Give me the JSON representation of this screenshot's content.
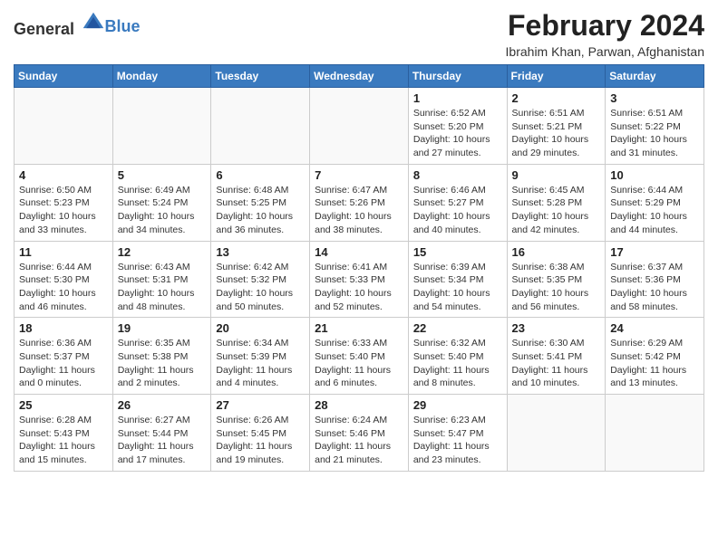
{
  "logo": {
    "general": "General",
    "blue": "Blue"
  },
  "header": {
    "title": "February 2024",
    "subtitle": "Ibrahim Khan, Parwan, Afghanistan"
  },
  "weekdays": [
    "Sunday",
    "Monday",
    "Tuesday",
    "Wednesday",
    "Thursday",
    "Friday",
    "Saturday"
  ],
  "weeks": [
    [
      {
        "day": "",
        "info": ""
      },
      {
        "day": "",
        "info": ""
      },
      {
        "day": "",
        "info": ""
      },
      {
        "day": "",
        "info": ""
      },
      {
        "day": "1",
        "info": "Sunrise: 6:52 AM\nSunset: 5:20 PM\nDaylight: 10 hours and 27 minutes."
      },
      {
        "day": "2",
        "info": "Sunrise: 6:51 AM\nSunset: 5:21 PM\nDaylight: 10 hours and 29 minutes."
      },
      {
        "day": "3",
        "info": "Sunrise: 6:51 AM\nSunset: 5:22 PM\nDaylight: 10 hours and 31 minutes."
      }
    ],
    [
      {
        "day": "4",
        "info": "Sunrise: 6:50 AM\nSunset: 5:23 PM\nDaylight: 10 hours and 33 minutes."
      },
      {
        "day": "5",
        "info": "Sunrise: 6:49 AM\nSunset: 5:24 PM\nDaylight: 10 hours and 34 minutes."
      },
      {
        "day": "6",
        "info": "Sunrise: 6:48 AM\nSunset: 5:25 PM\nDaylight: 10 hours and 36 minutes."
      },
      {
        "day": "7",
        "info": "Sunrise: 6:47 AM\nSunset: 5:26 PM\nDaylight: 10 hours and 38 minutes."
      },
      {
        "day": "8",
        "info": "Sunrise: 6:46 AM\nSunset: 5:27 PM\nDaylight: 10 hours and 40 minutes."
      },
      {
        "day": "9",
        "info": "Sunrise: 6:45 AM\nSunset: 5:28 PM\nDaylight: 10 hours and 42 minutes."
      },
      {
        "day": "10",
        "info": "Sunrise: 6:44 AM\nSunset: 5:29 PM\nDaylight: 10 hours and 44 minutes."
      }
    ],
    [
      {
        "day": "11",
        "info": "Sunrise: 6:44 AM\nSunset: 5:30 PM\nDaylight: 10 hours and 46 minutes."
      },
      {
        "day": "12",
        "info": "Sunrise: 6:43 AM\nSunset: 5:31 PM\nDaylight: 10 hours and 48 minutes."
      },
      {
        "day": "13",
        "info": "Sunrise: 6:42 AM\nSunset: 5:32 PM\nDaylight: 10 hours and 50 minutes."
      },
      {
        "day": "14",
        "info": "Sunrise: 6:41 AM\nSunset: 5:33 PM\nDaylight: 10 hours and 52 minutes."
      },
      {
        "day": "15",
        "info": "Sunrise: 6:39 AM\nSunset: 5:34 PM\nDaylight: 10 hours and 54 minutes."
      },
      {
        "day": "16",
        "info": "Sunrise: 6:38 AM\nSunset: 5:35 PM\nDaylight: 10 hours and 56 minutes."
      },
      {
        "day": "17",
        "info": "Sunrise: 6:37 AM\nSunset: 5:36 PM\nDaylight: 10 hours and 58 minutes."
      }
    ],
    [
      {
        "day": "18",
        "info": "Sunrise: 6:36 AM\nSunset: 5:37 PM\nDaylight: 11 hours and 0 minutes."
      },
      {
        "day": "19",
        "info": "Sunrise: 6:35 AM\nSunset: 5:38 PM\nDaylight: 11 hours and 2 minutes."
      },
      {
        "day": "20",
        "info": "Sunrise: 6:34 AM\nSunset: 5:39 PM\nDaylight: 11 hours and 4 minutes."
      },
      {
        "day": "21",
        "info": "Sunrise: 6:33 AM\nSunset: 5:40 PM\nDaylight: 11 hours and 6 minutes."
      },
      {
        "day": "22",
        "info": "Sunrise: 6:32 AM\nSunset: 5:40 PM\nDaylight: 11 hours and 8 minutes."
      },
      {
        "day": "23",
        "info": "Sunrise: 6:30 AM\nSunset: 5:41 PM\nDaylight: 11 hours and 10 minutes."
      },
      {
        "day": "24",
        "info": "Sunrise: 6:29 AM\nSunset: 5:42 PM\nDaylight: 11 hours and 13 minutes."
      }
    ],
    [
      {
        "day": "25",
        "info": "Sunrise: 6:28 AM\nSunset: 5:43 PM\nDaylight: 11 hours and 15 minutes."
      },
      {
        "day": "26",
        "info": "Sunrise: 6:27 AM\nSunset: 5:44 PM\nDaylight: 11 hours and 17 minutes."
      },
      {
        "day": "27",
        "info": "Sunrise: 6:26 AM\nSunset: 5:45 PM\nDaylight: 11 hours and 19 minutes."
      },
      {
        "day": "28",
        "info": "Sunrise: 6:24 AM\nSunset: 5:46 PM\nDaylight: 11 hours and 21 minutes."
      },
      {
        "day": "29",
        "info": "Sunrise: 6:23 AM\nSunset: 5:47 PM\nDaylight: 11 hours and 23 minutes."
      },
      {
        "day": "",
        "info": ""
      },
      {
        "day": "",
        "info": ""
      }
    ]
  ]
}
